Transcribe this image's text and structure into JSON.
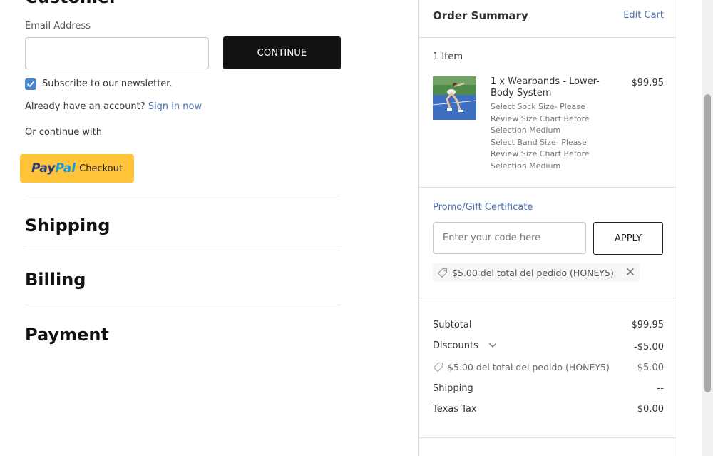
{
  "customer": {
    "section_title": "Customer",
    "email_label": "Email Address",
    "email_value": "",
    "continue_label": "CONTINUE",
    "subscribe_label": "Subscribe to our newsletter.",
    "subscribe_checked": true,
    "account_prompt": "Already have an account?",
    "sign_in_label": "Sign in now",
    "continue_with_label": "Or continue with",
    "paypal": {
      "pay": "Pay",
      "pal": "Pal",
      "checkout": "Checkout"
    }
  },
  "sections": {
    "shipping": "Shipping",
    "billing": "Billing",
    "payment": "Payment"
  },
  "order_summary": {
    "title": "Order Summary",
    "edit_cart": "Edit Cart",
    "item_count": "1 Item",
    "item": {
      "name": "1 x Wearbands - Lower-Body System",
      "price": "$99.95",
      "options": [
        "Select Sock Size- Please Review Size Chart Before Selection Medium",
        "Select Band Size- Please Review Size Chart Before Selection Medium"
      ]
    },
    "promo": {
      "label": "Promo/Gift Certificate",
      "placeholder": "Enter your code here",
      "apply_label": "APPLY",
      "applied_coupon": "$5.00 del total del pedido (HONEY5)"
    },
    "totals": {
      "subtotal_label": "Subtotal",
      "subtotal_value": "$99.95",
      "discounts_label": "Discounts",
      "discounts_value": "-$5.00",
      "discount_detail_label": "$5.00 del total del pedido (HONEY5)",
      "discount_detail_value": "-$5.00",
      "shipping_label": "Shipping",
      "shipping_value": "--",
      "tax_label": "Texas Tax",
      "tax_value": "$0.00"
    }
  },
  "icons": {
    "checkbox": "check-icon",
    "coupon": "tag-icon",
    "remove": "close-icon",
    "discounts_toggle": "chevron-down-icon"
  },
  "colors": {
    "accent_link": "#4a6fb5",
    "checkbox": "#4a86cf",
    "continue_button": "#111111",
    "paypal_yellow": "#ffc439"
  }
}
